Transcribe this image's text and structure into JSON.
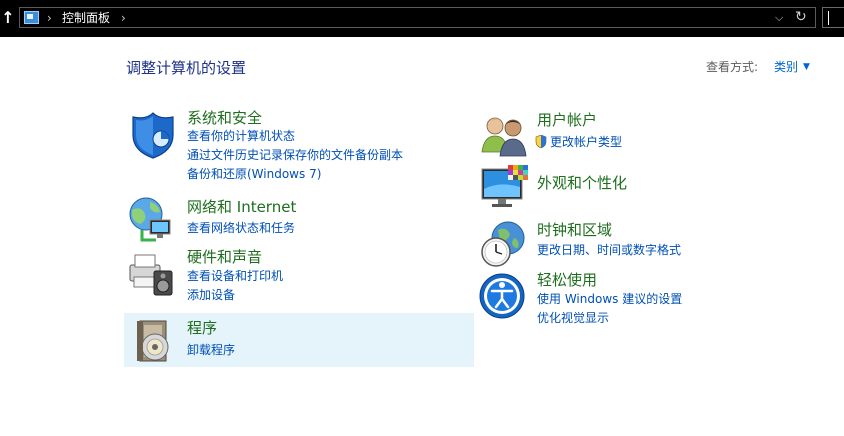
{
  "address_bar": {
    "breadcrumb": "控制面板"
  },
  "content": {
    "title": "调整计算机的设置",
    "view_by_label": "查看方式:",
    "view_by_value": "类别"
  },
  "categories": {
    "system_security": {
      "title": "系统和安全",
      "links": [
        "查看你的计算机状态",
        "通过文件历史记录保存你的文件备份副本",
        "备份和还原(Windows 7)"
      ]
    },
    "network_internet": {
      "title": "网络和 Internet",
      "links": [
        "查看网络状态和任务"
      ]
    },
    "hardware_sound": {
      "title": "硬件和声音",
      "links": [
        "查看设备和打印机",
        "添加设备"
      ]
    },
    "programs": {
      "title": "程序",
      "links": [
        "卸载程序"
      ]
    },
    "user_accounts": {
      "title": "用户帐户",
      "links": [
        "更改帐户类型"
      ]
    },
    "appearance": {
      "title": "外观和个性化",
      "links": []
    },
    "clock_region": {
      "title": "时钟和区域",
      "links": [
        "更改日期、时间或数字格式"
      ]
    },
    "ease_of_access": {
      "title": "轻松使用",
      "links": [
        "使用 Windows 建议的设置",
        "优化视觉显示"
      ]
    }
  },
  "icons": {
    "up": "up-arrow-icon",
    "control_panel": "control-panel-icon",
    "chevron": "chevron-down-icon",
    "refresh": "refresh-icon",
    "shield": "uac-shield-icon"
  },
  "colors": {
    "address_bar_bg": "#000000",
    "title_blue": "#1e3287",
    "category_green": "#1e6e1e",
    "link_blue": "#0050b4",
    "hover_bg": "#e5f3fb"
  }
}
